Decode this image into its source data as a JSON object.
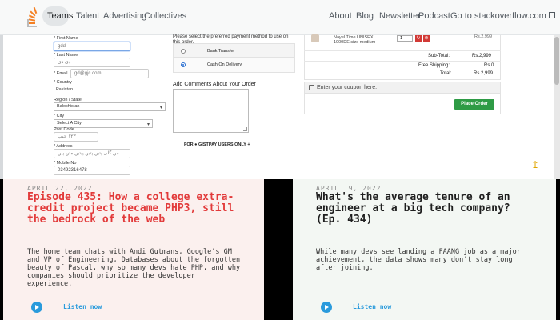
{
  "nav": {
    "items": [
      "Teams",
      "Talent",
      "Advertising",
      "Collectives"
    ],
    "right": [
      "About",
      "Blog",
      "Newsletter",
      "Podcast",
      "Go to stackoverflow.com"
    ]
  },
  "form": {
    "first_name_label": "* First Name",
    "first_name_value": "gdd",
    "last_name_label": "* Last Name",
    "last_name_value": "دی دی",
    "email_label": "* Email",
    "email_value": "gd@gjc.com",
    "country_label": "* Country",
    "country_value": "Pakistan",
    "region_label": "Region / State",
    "region_value": "Balochistan",
    "city_label": "* City",
    "city_value": "Select A City",
    "postcode_label": "Post Code",
    "postcode_value": "١٢٣ جیپ",
    "address_label": "* Address",
    "address_value": "من گلی پتیں پتیں پیتیں متن پیں",
    "mobile_label": "* Mobile No",
    "mobile_value": "03492316478"
  },
  "payment": {
    "instruction": "Please select the preferred payment method to use on this order.",
    "options": [
      "Bank Transfer",
      "Cash On Delivery"
    ],
    "selected": "Cash On Delivery",
    "comments_label": "Add Comments About Your Order",
    "offer_text": "FOR ● GISTPAY USERS ONLY  +"
  },
  "order": {
    "product_name": "Nayel Time UNISEX 1000DE size medium",
    "quantity": "1",
    "product_price": "Rs.2,999",
    "subtotal_label": "Sub-Total:",
    "subtotal_value": "Rs.2,999",
    "shipping_label": "Free Shipping:",
    "shipping_value": "Rs.0",
    "total_label": "Total:",
    "total_value": "Rs.2,999",
    "coupon_text": "Enter your coupon here:",
    "place_order": "Place Order"
  },
  "cards": [
    {
      "date": "APRIL 22, 2022",
      "title": "Episode 435: How a college extra-credit project became PHP3, still the bedrock of the web",
      "desc": "The home team chats with Andi Gutmans, Google's GM and VP of Engineering, Databases about the forgotten beauty of Pascal, why so many devs hate PHP, and why companies should prioritize the developer experience.",
      "listen": "Listen now",
      "accent": "#e23a3a",
      "bg": "#fbf0ee",
      "play_color": "#2a9bdc"
    },
    {
      "date": "APRIL 19, 2022",
      "title": "What's the average tenure of an engineer at a big tech company? (Ep. 434)",
      "desc": "While many devs see landing a FAANG job as a major achievement, the data shows many don't stay long after joining.",
      "listen": "Listen now",
      "accent": "#1f1f1f",
      "bg": "#f3f7f3",
      "play_color": "#2a9bdc"
    }
  ]
}
